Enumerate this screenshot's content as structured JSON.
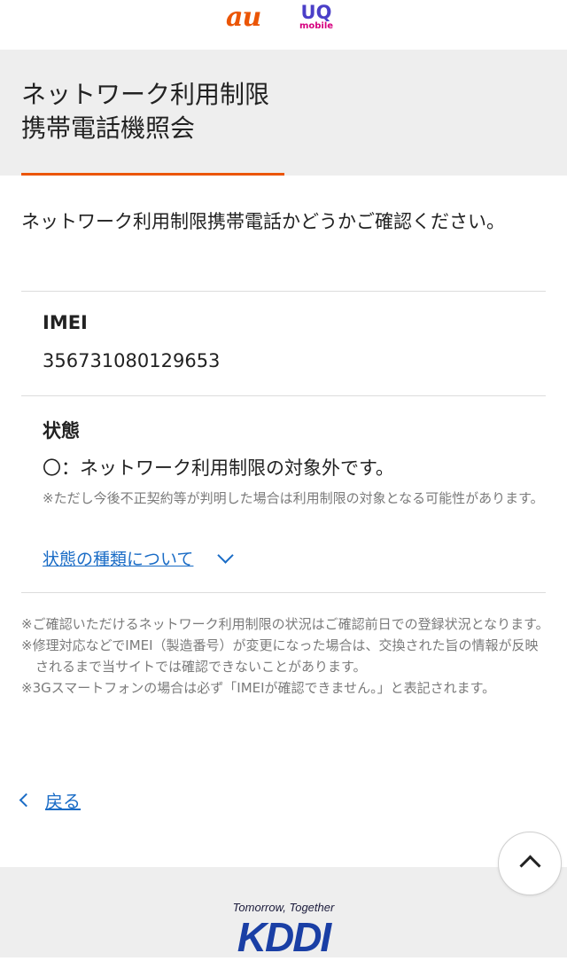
{
  "header": {
    "au_logo": "au",
    "uq_logo": "UQ",
    "uq_logo_sub": "mobile"
  },
  "page": {
    "title_lines": [
      "ネットワーク利用制限",
      "携帯電話機照会"
    ],
    "intro": "ネットワーク利用制限携帯電話かどうかご確認ください。"
  },
  "imei": {
    "label": "IMEI",
    "value": "356731080129653"
  },
  "status": {
    "label": "状態",
    "text": "〇：ネットワーク利用制限の対象外です。",
    "note": "※ただし今後不正契約等が判明した場合は利用制限の対象となる可能性があります。",
    "link": "状態の種類について"
  },
  "notes": [
    "※ご確認いただけるネットワーク利用制限の状況はご確認前日での登録状況となります。",
    "※修理対応などでIMEI（製造番号）が変更になった場合は、交換された旨の情報が反映されるまで当サイトでは確認できないことがあります。",
    "※3Gスマートフォンの場合は必ず「IMEIが確認できません。」と表記されます。"
  ],
  "nav": {
    "back": "戻る"
  },
  "footer": {
    "tagline": "Tomorrow, Together",
    "logo": "KDDI"
  },
  "icons": {
    "back": "chevron-left-icon",
    "expand": "chevron-down-icon",
    "scroll_top": "chevron-up-icon"
  },
  "colors": {
    "accent": "#eb5505",
    "link": "#1a6cc6",
    "band": "#eeeeee"
  }
}
